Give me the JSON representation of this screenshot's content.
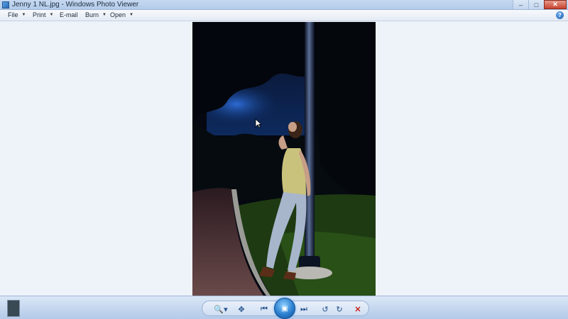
{
  "window": {
    "title": "Jenny 1 NL.jpg - Windows Photo Viewer",
    "controls": {
      "minimize": "–",
      "maximize": "□",
      "close": "✕"
    }
  },
  "menu": {
    "file": "File",
    "print": "Print",
    "email": "E-mail",
    "burn": "Burn",
    "open": "Open",
    "caret": "▼",
    "help": "?"
  },
  "photo": {
    "icon": "photo-of-woman-leaning-on-lamp-post"
  },
  "controls": {
    "zoom": "🔍▾",
    "fit": "✥",
    "previous": "⏮",
    "slideshow": "▣",
    "next": "⏭",
    "rotate_ccw": "↺",
    "rotate_cw": "↻",
    "delete": "✕"
  },
  "colors": {
    "accent": "#2b7fd0",
    "delete": "#cc2222"
  }
}
